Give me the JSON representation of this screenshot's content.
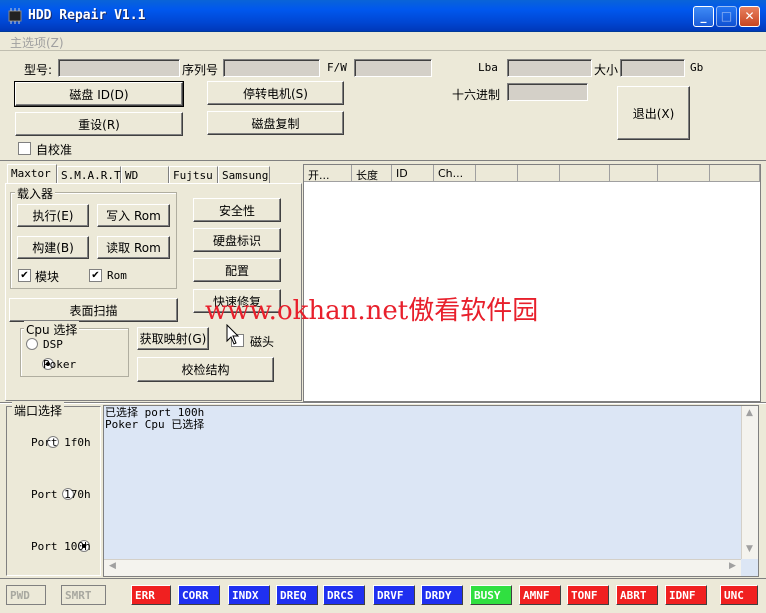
{
  "window": {
    "title": "HDD Repair V1.1",
    "min": "_",
    "max": "□",
    "close": "✕"
  },
  "menu": {
    "main": "主选项(Z)"
  },
  "info": {
    "model_label": "型号:",
    "serial_label": "序列号",
    "fw_label": "F/W",
    "lba_label": "Lba",
    "size_label": "大小",
    "size_unit": "Gb",
    "hex_label": "十六进制",
    "model_value": "",
    "serial_value": "",
    "fw_value": "",
    "lba_value": "",
    "size_value": "",
    "hex_value": ""
  },
  "buttons": {
    "disk_id": "磁盘 ID(D)",
    "stop_motor": "停转电机(S)",
    "reset": "重设(R)",
    "disk_copy": "磁盘复制",
    "exit": "退出(X)",
    "self_calibrate": "自校准"
  },
  "tabs": [
    "Maxtor",
    "S.M.A.R.T",
    "WD",
    "Fujtsu",
    "Samsung"
  ],
  "maxtor": {
    "loader_group": "载入器",
    "exec": "执行(E)",
    "write_rom": "写入 Rom",
    "build": "构建(B)",
    "read_rom": "读取 Rom",
    "module_cb": "模块",
    "rom_cb": "Rom",
    "security": "安全性",
    "hd_id": "硬盘标识",
    "config": "配置",
    "quick_fix": "快速修复",
    "surface_scan": "表面扫描",
    "cpu_group": "Cpu 选择",
    "dsp": "DSP",
    "poker": "Poker",
    "get_map": "获取映射(G)",
    "heads": "磁头",
    "check_struct": "校检结构"
  },
  "list_columns": [
    "开...",
    "长度",
    "ID",
    "Ch...",
    "",
    "",
    "",
    "",
    "",
    "",
    ""
  ],
  "port": {
    "group": "端口选择",
    "options": [
      "Port 1f0h",
      "Port 170h",
      "Port 100h"
    ],
    "selected": 2
  },
  "log": [
    "已选择 port 100h",
    "Poker Cpu 已选择"
  ],
  "status": [
    {
      "label": "PWD",
      "style": "off"
    },
    {
      "label": "SMRT",
      "style": "off"
    },
    {
      "label": "ERR",
      "style": "red"
    },
    {
      "label": "CORR",
      "style": "blue"
    },
    {
      "label": "INDX",
      "style": "blue"
    },
    {
      "label": "DREQ",
      "style": "blue"
    },
    {
      "label": "DRCS",
      "style": "blue"
    },
    {
      "label": "DRVF",
      "style": "blue"
    },
    {
      "label": "DRDY",
      "style": "blue"
    },
    {
      "label": "BUSY",
      "style": "green"
    },
    {
      "label": "AMNF",
      "style": "red"
    },
    {
      "label": "TONF",
      "style": "red"
    },
    {
      "label": "ABRT",
      "style": "red"
    },
    {
      "label": "IDNF",
      "style": "red"
    },
    {
      "label": "UNC",
      "style": "red"
    }
  ],
  "colors": {
    "title_bar": "#0050E0",
    "status_blue": "#1F30F0",
    "status_red": "#F02020",
    "status_green": "#30E040",
    "log_bg": "#DCE6F5"
  },
  "watermark": "www.okhan.net傲看软件园"
}
